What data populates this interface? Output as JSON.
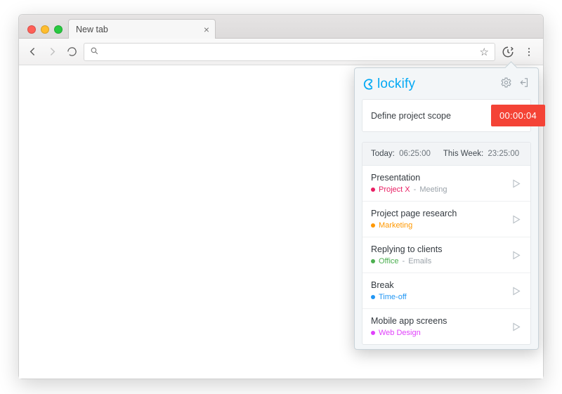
{
  "browser": {
    "tab_title": "New tab",
    "omnibox_value": ""
  },
  "popup": {
    "brand": "lockify",
    "task_value": "Define project scope",
    "timer": "00:00:04",
    "summary": {
      "today_label": "Today:",
      "today_value": "06:25:00",
      "week_label": "This Week:",
      "week_value": "23:25:00"
    },
    "entries": [
      {
        "title": "Presentation",
        "project": "Project X",
        "project_color": "#e91e63",
        "tag": "Meeting"
      },
      {
        "title": "Project page research",
        "project": "Marketing",
        "project_color": "#ff9800",
        "tag": ""
      },
      {
        "title": "Replying to clients",
        "project": "Office",
        "project_color": "#4caf50",
        "tag": "Emails"
      },
      {
        "title": "Break",
        "project": "Time-off",
        "project_color": "#2196f3",
        "tag": ""
      },
      {
        "title": "Mobile app screens",
        "project": "Web Design",
        "project_color": "#e040fb",
        "tag": ""
      }
    ]
  }
}
